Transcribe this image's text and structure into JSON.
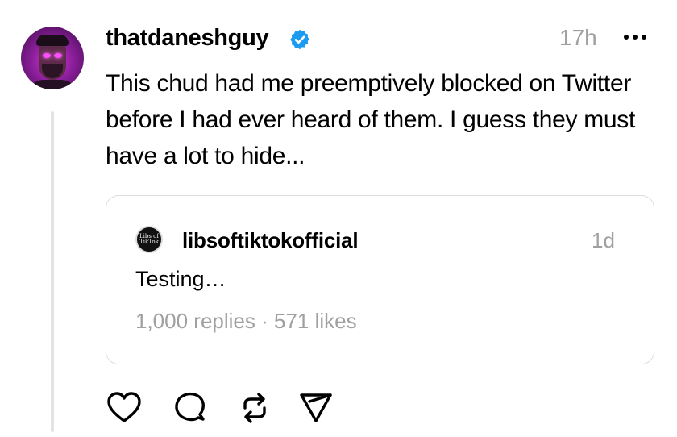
{
  "post": {
    "username": "thatdaneshguy",
    "timestamp": "17h",
    "text": "This chud had me preemptively blocked on Twitter before I had ever heard of them. I guess they must have a lot to hide...",
    "avatar_icon": "profile-photo",
    "verified_icon": "verified-badge-icon",
    "more_icon": "more-options-icon"
  },
  "quote": {
    "username": "libsoftiktokofficial",
    "timestamp": "1d",
    "text": "Testing…",
    "stats": "1,000 replies · 571 likes",
    "avatar_text": "Libs of TikTok"
  },
  "actions": [
    {
      "name": "like",
      "icon": "heart-icon"
    },
    {
      "name": "reply",
      "icon": "comment-icon"
    },
    {
      "name": "repost",
      "icon": "repost-icon"
    },
    {
      "name": "share",
      "icon": "send-icon"
    }
  ],
  "colors": {
    "verified": "#1d9bf0",
    "muted_text": "#a0a0a0",
    "border": "#dedede",
    "thread_line": "#e3e3e3"
  }
}
